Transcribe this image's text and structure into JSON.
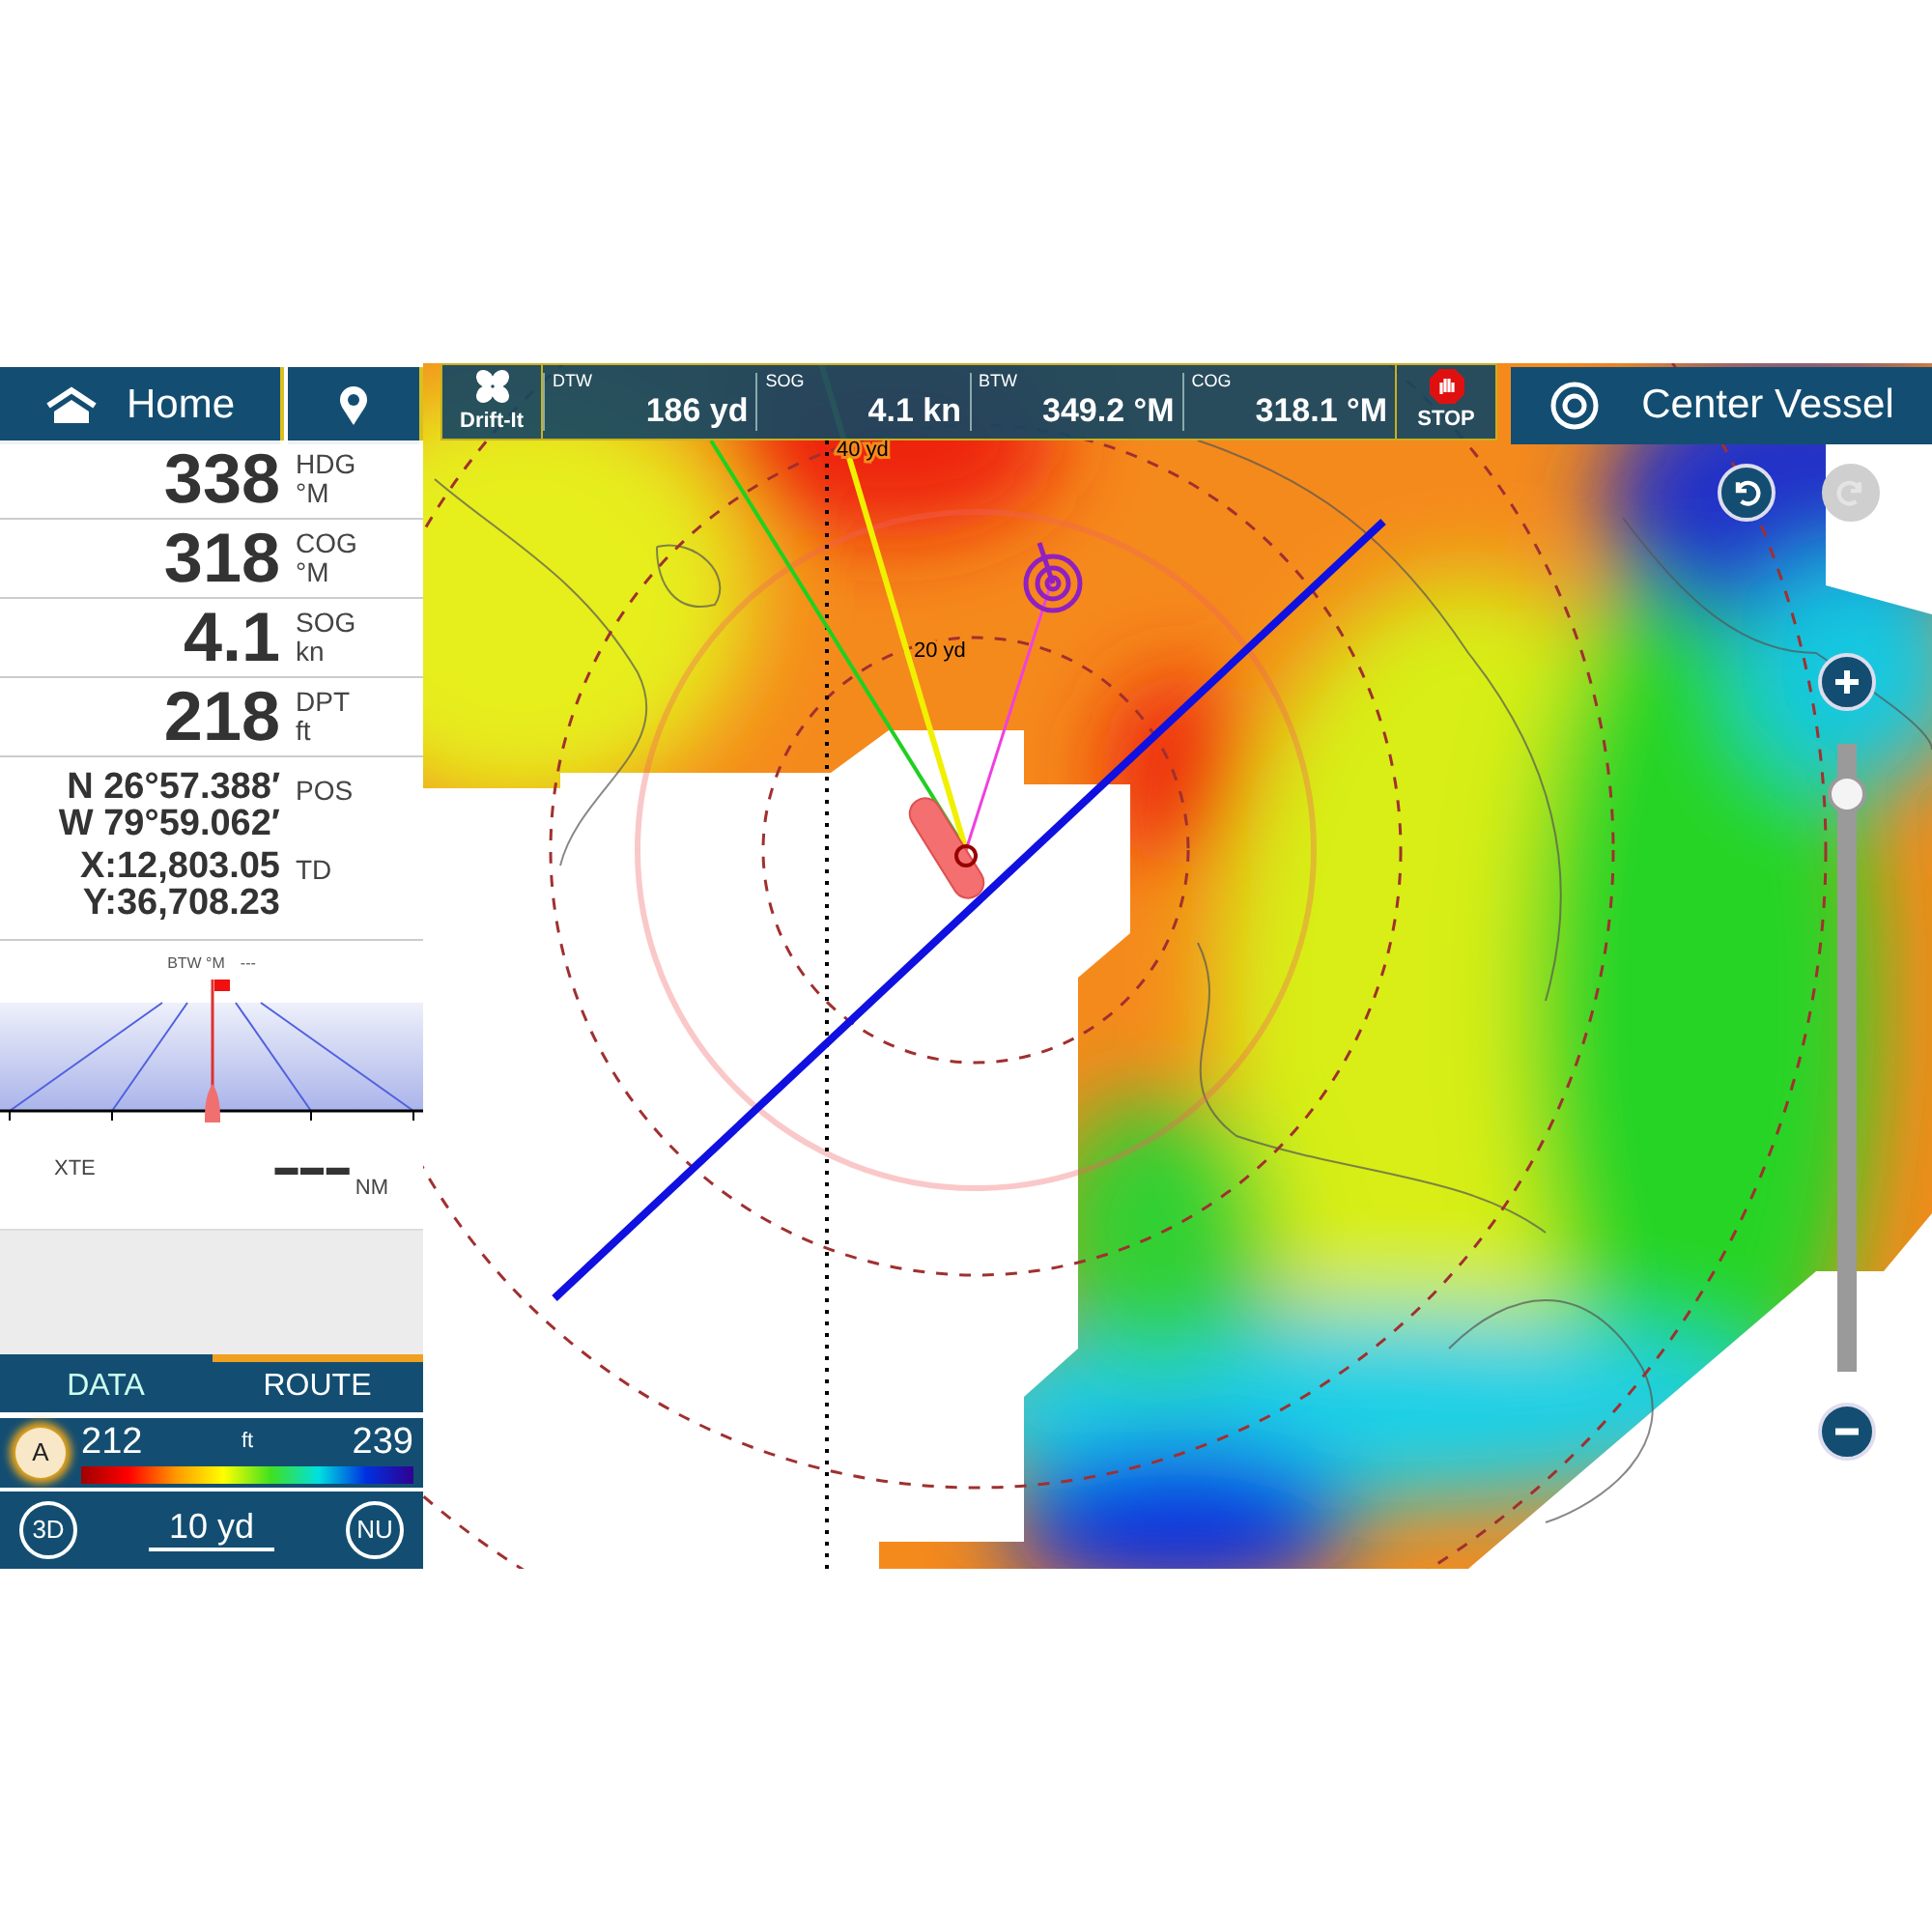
{
  "top_bar": {
    "home": "Home",
    "drift": "Drift-It",
    "stop": "STOP",
    "center": "Center Vessel",
    "readouts": [
      {
        "label": "DTW",
        "value": "186 yd"
      },
      {
        "label": "SOG",
        "value": "4.1 kn"
      },
      {
        "label": "BTW",
        "value": "349.2 °M"
      },
      {
        "label": "COG",
        "value": "318.1 °M"
      }
    ]
  },
  "data_rows": [
    {
      "value": "338",
      "label": "HDG",
      "unit": "°M"
    },
    {
      "value": "318",
      "label": "COG",
      "unit": "°M"
    },
    {
      "value": "4.1",
      "label": "SOG",
      "unit": "kn"
    },
    {
      "value": "218",
      "label": "DPT",
      "unit": "ft"
    }
  ],
  "position": {
    "lines": [
      "N 26°57.388′",
      "W 79°59.062′"
    ],
    "label": "POS"
  },
  "td": {
    "lines": [
      "X:12,803.05",
      "Y:36,708.23"
    ],
    "label": "TD"
  },
  "highway": {
    "btw_label": "BTW °M",
    "btw_value": "---",
    "xte_label": "XTE",
    "xte_value": "▬ ▬ ▬",
    "xte_unit": "NM"
  },
  "tabs": [
    {
      "label": "DATA",
      "selected": false
    },
    {
      "label": "ROUTE",
      "selected": true
    }
  ],
  "depth_scale": {
    "mode": "A",
    "min": "212",
    "unit": "ft",
    "max": "239"
  },
  "bottom_bar": {
    "view": "3D",
    "scale": "10 yd",
    "orientation": "NU"
  },
  "map": {
    "range_labels": [
      "40 yd",
      "20 yd"
    ]
  },
  "history": [
    {
      "kind": "undo",
      "disabled": false
    },
    {
      "kind": "redo",
      "disabled": true
    }
  ],
  "zoom": {
    "level": 0.92
  }
}
